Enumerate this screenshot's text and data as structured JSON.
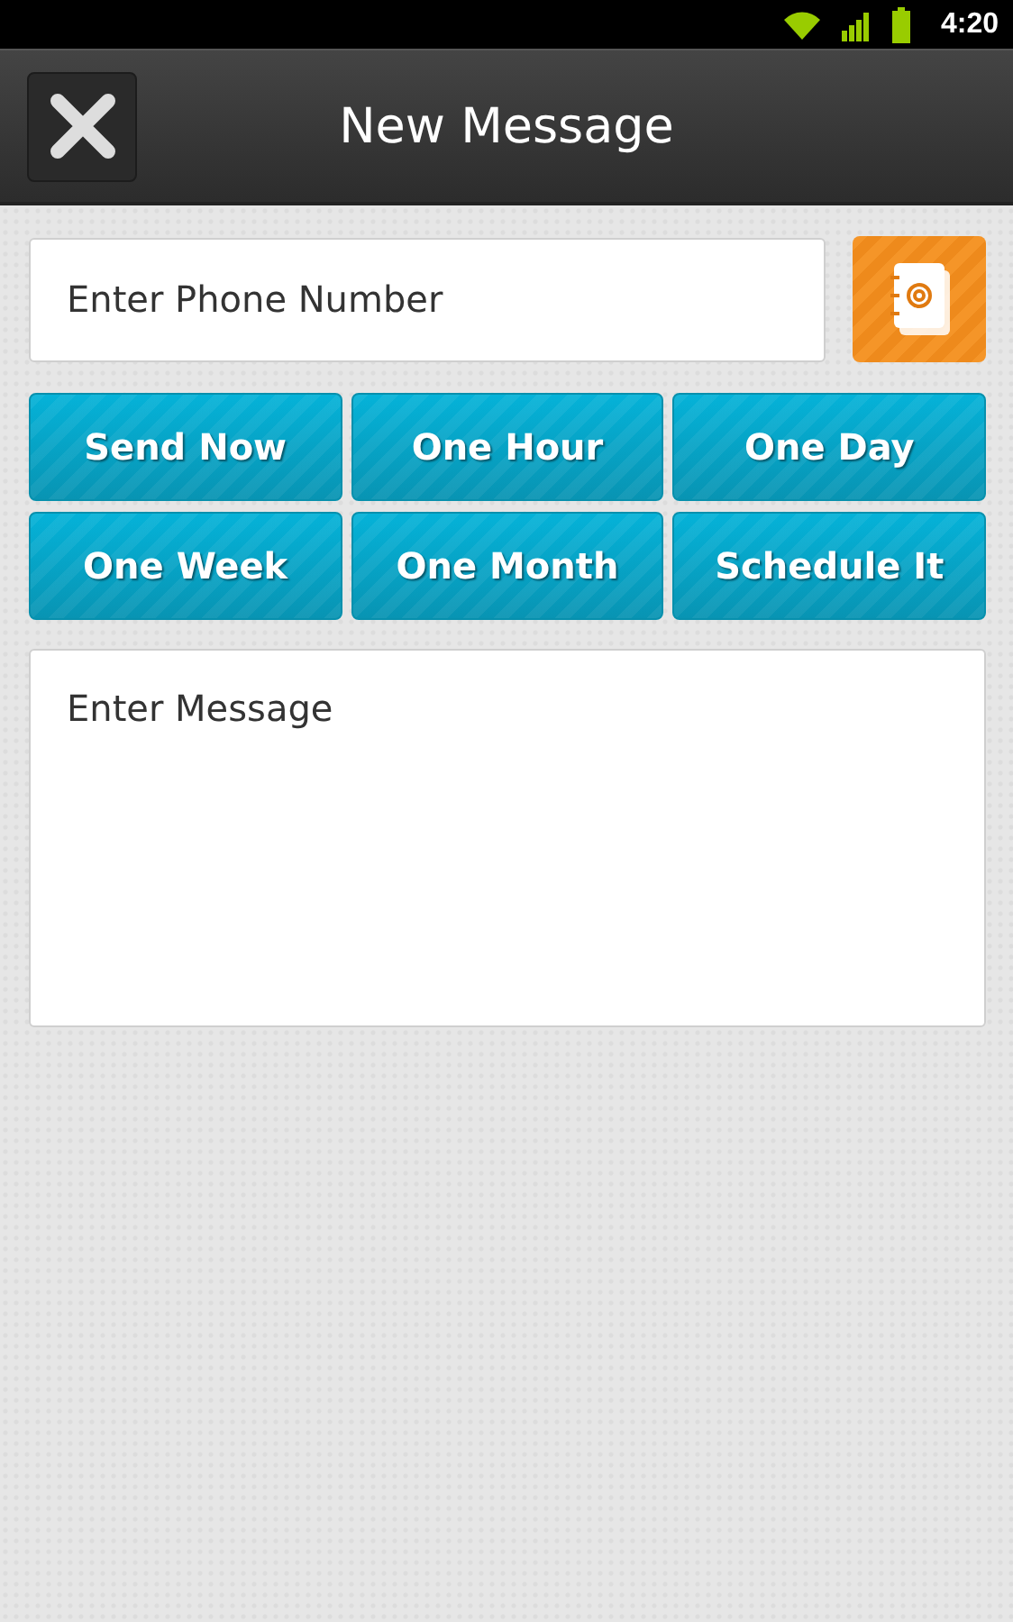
{
  "status_bar": {
    "time": "4:20"
  },
  "header": {
    "title": "New Message"
  },
  "phone_field": {
    "placeholder": "Enter Phone Number"
  },
  "schedule_buttons": [
    {
      "label": "Send Now"
    },
    {
      "label": "One Hour"
    },
    {
      "label": "One Day"
    },
    {
      "label": "One Week"
    },
    {
      "label": "One Month"
    },
    {
      "label": "Schedule It"
    }
  ],
  "message_field": {
    "placeholder": "Enter Message"
  }
}
